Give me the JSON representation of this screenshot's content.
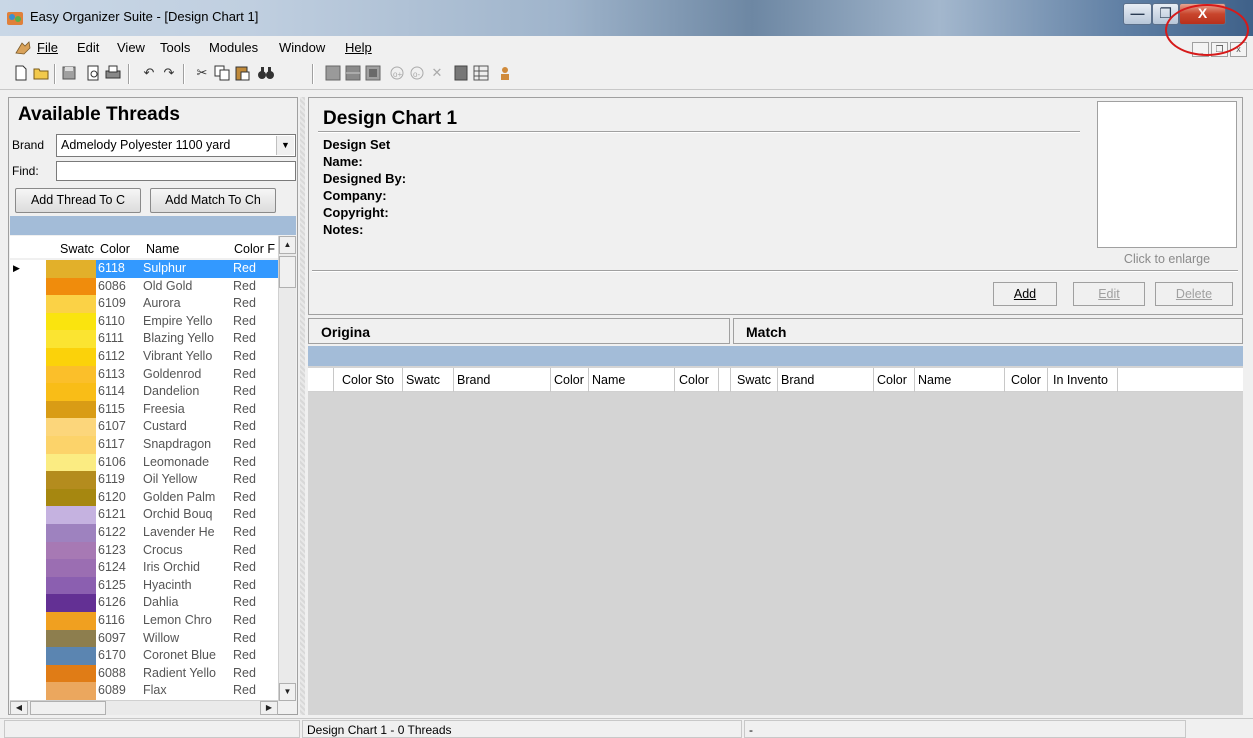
{
  "window": {
    "title": "Easy Organizer Suite - [Design Chart 1]",
    "close_glyph": "X",
    "min_glyph": "—",
    "max_glyph": "❐"
  },
  "menu": {
    "file": "File",
    "edit": "Edit",
    "view": "View",
    "tools": "Tools",
    "modules": "Modules",
    "window": "Window",
    "help": "Help",
    "mdi_min": "_",
    "mdi_restore": "❐",
    "mdi_close": "x"
  },
  "threads": {
    "title": "Available Threads",
    "brand_label": "Brand",
    "brand_value": "Admelody Polyester 1100 yard",
    "find_label": "Find:",
    "find_value": "",
    "add_thread_button": "Add Thread To C",
    "add_match_button": "Add Match To Ch",
    "columns": [
      "Swatc",
      "Color",
      "Name",
      "Color F"
    ],
    "rows": [
      {
        "color_num": "6118",
        "name": "Sulphur",
        "family": "Red",
        "swatch": "#e2b02a",
        "selected": true
      },
      {
        "color_num": "6086",
        "name": "Old Gold",
        "family": "Red",
        "swatch": "#f08c0c"
      },
      {
        "color_num": "6109",
        "name": "Aurora",
        "family": "Red",
        "swatch": "#fbd246"
      },
      {
        "color_num": "6110",
        "name": "Empire Yello",
        "family": "Red",
        "swatch": "#fae40e"
      },
      {
        "color_num": "6111",
        "name": "Blazing Yello",
        "family": "Red",
        "swatch": "#fbe431"
      },
      {
        "color_num": "6112",
        "name": "Vibrant Yello",
        "family": "Red",
        "swatch": "#fbd20a"
      },
      {
        "color_num": "6113",
        "name": "Goldenrod",
        "family": "Red",
        "swatch": "#fbbf2a"
      },
      {
        "color_num": "6114",
        "name": "Dandelion",
        "family": "Red",
        "swatch": "#f9bd17"
      },
      {
        "color_num": "6115",
        "name": "Freesia",
        "family": "Red",
        "swatch": "#d99c15"
      },
      {
        "color_num": "6107",
        "name": "Custard",
        "family": "Red",
        "swatch": "#fcd67b"
      },
      {
        "color_num": "6117",
        "name": "Snapdragon",
        "family": "Red",
        "swatch": "#fcd36a"
      },
      {
        "color_num": "6106",
        "name": "Leomonade",
        "family": "Red",
        "swatch": "#fbec82"
      },
      {
        "color_num": "6119",
        "name": "Oil Yellow",
        "family": "Red",
        "swatch": "#b48c1e"
      },
      {
        "color_num": "6120",
        "name": "Golden Palm",
        "family": "Red",
        "swatch": "#a68710"
      },
      {
        "color_num": "6121",
        "name": "Orchid Bouq",
        "family": "Red",
        "swatch": "#c5b2e0"
      },
      {
        "color_num": "6122",
        "name": "Lavender He",
        "family": "Red",
        "swatch": "#9e82bf"
      },
      {
        "color_num": "6123",
        "name": "Crocus",
        "family": "Red",
        "swatch": "#a779b4"
      },
      {
        "color_num": "6124",
        "name": "Iris Orchid",
        "family": "Red",
        "swatch": "#9b6eb2"
      },
      {
        "color_num": "6125",
        "name": "Hyacinth",
        "family": "Red",
        "swatch": "#8b5fb0"
      },
      {
        "color_num": "6126",
        "name": "Dahlia",
        "family": "Red",
        "swatch": "#633094"
      },
      {
        "color_num": "6116",
        "name": "Lemon Chro",
        "family": "Red",
        "swatch": "#f0a020"
      },
      {
        "color_num": "6097",
        "name": "Willow",
        "family": "Red",
        "swatch": "#8d7e4e"
      },
      {
        "color_num": "6170",
        "name": "Coronet Blue",
        "family": "Red",
        "swatch": "#5b85b1"
      },
      {
        "color_num": "6088",
        "name": "Radient Yello",
        "family": "Red",
        "swatch": "#e07c16"
      },
      {
        "color_num": "6089",
        "name": "Flax",
        "family": "Red",
        "swatch": "#eba75e"
      }
    ]
  },
  "design": {
    "title": "Design Chart 1",
    "set_label": "Design Set",
    "name_label": "Name:",
    "designed_by_label": "Designed By:",
    "company_label": "Company:",
    "copyright_label": "Copyright:",
    "notes_label": "Notes:",
    "click_enlarge": "Click to enlarge",
    "add_button": "Add",
    "edit_button": "Edit",
    "delete_button": "Delete",
    "original_header": "Origina",
    "match_header": "Match",
    "columns": [
      "Color Sto",
      "Swatc",
      "Brand",
      "Color",
      "Name",
      "Color",
      "Swatc",
      "Brand",
      "Color",
      "Name",
      "Color",
      "In Invento"
    ]
  },
  "status": {
    "left": "Design Chart 1 - 0 Threads",
    "right": "-"
  }
}
